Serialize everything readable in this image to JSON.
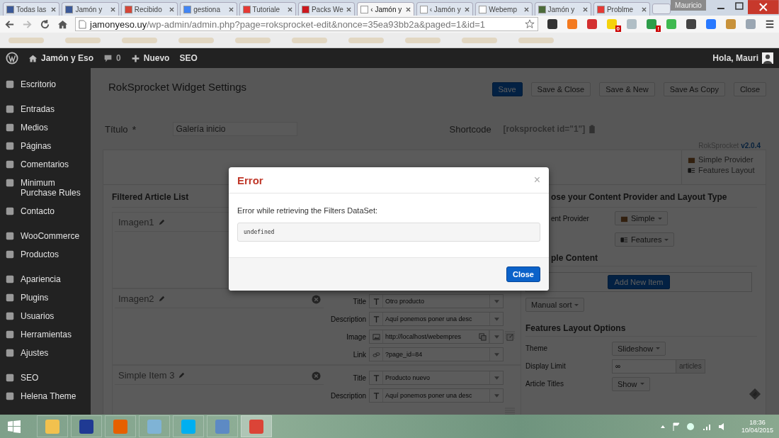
{
  "browser": {
    "tabs": [
      {
        "title": "Todas las",
        "selected": false
      },
      {
        "title": "Jamón y",
        "selected": false
      },
      {
        "title": "Recibido",
        "selected": false
      },
      {
        "title": "gestiona",
        "selected": false
      },
      {
        "title": "Tutoriale",
        "selected": false
      },
      {
        "title": "Packs We",
        "selected": false
      },
      {
        "title": "‹ Jamón y",
        "selected": true
      },
      {
        "title": "‹ Jamón y",
        "selected": false
      },
      {
        "title": "Webemp",
        "selected": false
      },
      {
        "title": "Jamón y",
        "selected": false
      },
      {
        "title": "Problme",
        "selected": false
      }
    ],
    "profile": "Mauricio",
    "url": {
      "domain": "jamonyeso.uy",
      "path": "/wp-admin/admin.php?page=roksprocket-edit&nonce=35ea93bb2a&paged=1&id=1"
    },
    "extension_badges": [
      "0",
      "!"
    ]
  },
  "admin_bar": {
    "site": "Jamón y Eso",
    "comments": "0",
    "new": "Nuevo",
    "seo": "SEO",
    "greeting": "Hola, Mauri"
  },
  "sidebar": {
    "groups": [
      [
        "Escritorio"
      ],
      [
        "Entradas",
        "Medios",
        "Páginas",
        "Comentarios",
        "Minimum Purchase Rules",
        "Contacto"
      ],
      [
        "WooCommerce",
        "Productos"
      ],
      [
        "Apariencia",
        "Plugins",
        "Usuarios",
        "Herramientas",
        "Ajustes"
      ],
      [
        "SEO",
        "Helena Theme"
      ]
    ]
  },
  "page": {
    "title": "RokSprocket Widget Settings",
    "buttons": [
      {
        "label": "Save",
        "primary": true
      },
      {
        "label": "Save & Close",
        "primary": false
      },
      {
        "label": "Save & New",
        "primary": false
      },
      {
        "label": "Save As Copy",
        "primary": false
      },
      {
        "label": "Close",
        "primary": false
      }
    ],
    "title_field": {
      "label": "Título",
      "required_mark": "*",
      "value": "Galería inicio"
    },
    "shortcode": {
      "label": "Shortcode",
      "value": "[roksprocket id=\"1\"]"
    },
    "version": {
      "name": "RokSprocket",
      "number": "v2.0.4"
    },
    "provider_box": [
      "Simple Provider",
      "Features Layout"
    ],
    "article_list": {
      "title": "Filtered Article List",
      "items": [
        {
          "name": "Imagen1"
        },
        {
          "name": "Imagen2",
          "fields": [
            {
              "label": "Title",
              "kind": "text",
              "value": "Otro producto"
            },
            {
              "label": "Description",
              "kind": "text",
              "value": "Aquí ponemos poner una desc"
            },
            {
              "label": "Image",
              "kind": "image",
              "value": "http://localhost/webempres"
            },
            {
              "label": "Link",
              "kind": "link",
              "value": "?page_id=84"
            }
          ]
        },
        {
          "name": "Simple Item 3",
          "fields": [
            {
              "label": "Title",
              "kind": "text",
              "value": "Producto nuevo"
            },
            {
              "label": "Description",
              "kind": "text",
              "value": "Aquí ponemos poner una desc"
            }
          ]
        }
      ]
    },
    "right_panel": {
      "heading": "ose your Content Provider and Layout Type",
      "provider_label": "ent Provider",
      "provider": "Simple",
      "layout": "Features",
      "content_heading": "ple Content",
      "add_button": "Add New Item",
      "sort": "Manual sort",
      "options_heading": "Features Layout Options",
      "options": [
        {
          "label": "Theme",
          "kind": "dropdown",
          "value": "Slideshow"
        },
        {
          "label": "Display Limit",
          "kind": "input",
          "value": "∞",
          "addon": "articles"
        },
        {
          "label": "Article Titles",
          "kind": "dropdown",
          "value": "Show"
        }
      ]
    }
  },
  "modal": {
    "title": "Error",
    "close_glyph": "×",
    "message": "Error while retrieving the Filters DataSet:",
    "detail": "undefined",
    "button": "Close"
  },
  "taskbar": {
    "time": "18:36",
    "date": "10/04/2015"
  }
}
